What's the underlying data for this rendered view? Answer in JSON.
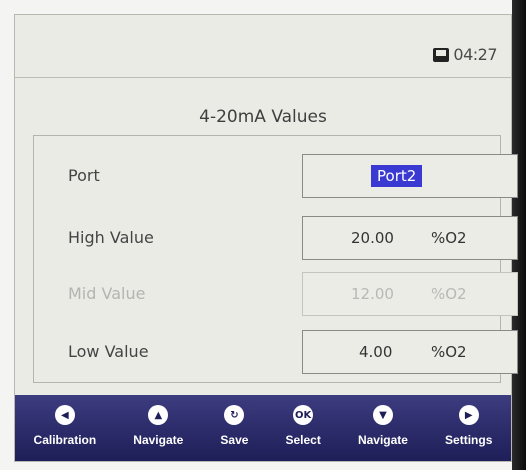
{
  "status": {
    "time": "04:27",
    "storage_icon": "sd-card-icon"
  },
  "screen_title": "4-20mA Values",
  "rows": [
    {
      "label": "Port",
      "value": "Port2",
      "selected": true
    },
    {
      "label": "High Value",
      "value": "20.00",
      "unit": "%O2",
      "enabled": true
    },
    {
      "label": "Mid Value",
      "value": "12.00",
      "unit": "%O2",
      "enabled": false
    },
    {
      "label": "Low Value",
      "value": "4.00",
      "unit": "%O2",
      "enabled": true
    }
  ],
  "softkeys": [
    {
      "label": "Calibration",
      "icon": "arrow-left-icon",
      "glyph": "◀"
    },
    {
      "label": "Navigate",
      "icon": "arrow-up-icon",
      "glyph": "▲"
    },
    {
      "label": "Save",
      "icon": "refresh-icon",
      "glyph": "↻"
    },
    {
      "label": "Select",
      "icon": "ok-icon",
      "glyph": "OK"
    },
    {
      "label": "Navigate",
      "icon": "arrow-down-icon",
      "glyph": "▼"
    },
    {
      "label": "Settings",
      "icon": "arrow-right-icon",
      "glyph": "▶"
    }
  ],
  "colors": {
    "softkey_bar": "#2a2a6c",
    "selection_highlight": "#3a3ad2",
    "screen_background": "#ebebe6"
  }
}
